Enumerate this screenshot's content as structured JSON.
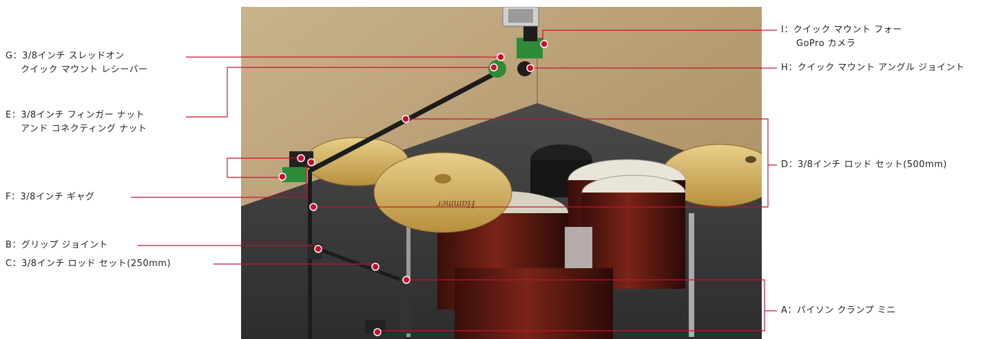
{
  "labels": {
    "G": {
      "line1": "G：3/8インチ スレッドオン",
      "line2": "クイック マウント レシーバー"
    },
    "E": {
      "line1": "E：3/8インチ フィンガー ナット",
      "line2": "アンド コネクティング ナット"
    },
    "F": {
      "line1": "F：3/8インチ ギャグ"
    },
    "B": {
      "line1": "B：グリップ ジョイント"
    },
    "C": {
      "line1": "C：3/8インチ ロッド セット(250mm)"
    },
    "I": {
      "line1": "I：クイック マウント フォー",
      "line2": "GoPro カメラ"
    },
    "H": {
      "line1": "H：クイック マウント アングル ジョイント"
    },
    "D": {
      "line1": "D：3/8インチ ロッド セット(500mm)"
    },
    "A": {
      "line1": "A：パイソン クランプ ミニ"
    }
  },
  "photo": {
    "cymbal_brand": "Hammer"
  },
  "colors": {
    "leader": "#c8102e",
    "dot": "#c8102e",
    "mount_green": "#2e8b3a"
  }
}
